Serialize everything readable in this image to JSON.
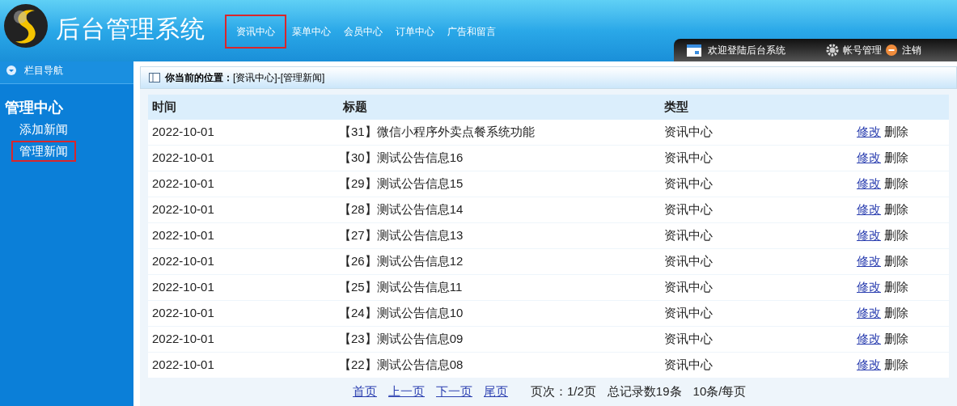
{
  "header": {
    "title": "后台管理系统",
    "nav": [
      {
        "label": "资讯中心",
        "selected": true
      },
      {
        "label": "菜单中心",
        "selected": false
      },
      {
        "label": "会员中心",
        "selected": false
      },
      {
        "label": "订单中心",
        "selected": false
      },
      {
        "label": "广告和留言",
        "selected": false
      }
    ],
    "welcome": "欢迎登陆后台系统",
    "account": "帐号管理",
    "logout": "注销"
  },
  "sidebar": {
    "heading": "栏目导航",
    "group": "管理中心",
    "items": [
      {
        "label": "添加新闻",
        "selected": false
      },
      {
        "label": "管理新闻",
        "selected": true
      }
    ]
  },
  "breadcrumb": {
    "label": "你当前的位置：",
    "path": "[资讯中心]-[管理新闻]"
  },
  "table": {
    "columns": [
      "时间",
      "标题",
      "类型",
      ""
    ],
    "rows": [
      {
        "time": "2022-10-01",
        "title": "【31】微信小程序外卖点餐系统功能",
        "type": "资讯中心",
        "edit": "修改",
        "delete": "删除"
      },
      {
        "time": "2022-10-01",
        "title": "【30】测试公告信息16",
        "type": "资讯中心",
        "edit": "修改",
        "delete": "删除"
      },
      {
        "time": "2022-10-01",
        "title": "【29】测试公告信息15",
        "type": "资讯中心",
        "edit": "修改",
        "delete": "删除"
      },
      {
        "time": "2022-10-01",
        "title": "【28】测试公告信息14",
        "type": "资讯中心",
        "edit": "修改",
        "delete": "删除"
      },
      {
        "time": "2022-10-01",
        "title": "【27】测试公告信息13",
        "type": "资讯中心",
        "edit": "修改",
        "delete": "删除"
      },
      {
        "time": "2022-10-01",
        "title": "【26】测试公告信息12",
        "type": "资讯中心",
        "edit": "修改",
        "delete": "删除"
      },
      {
        "time": "2022-10-01",
        "title": "【25】测试公告信息11",
        "type": "资讯中心",
        "edit": "修改",
        "delete": "删除"
      },
      {
        "time": "2022-10-01",
        "title": "【24】测试公告信息10",
        "type": "资讯中心",
        "edit": "修改",
        "delete": "删除"
      },
      {
        "time": "2022-10-01",
        "title": "【23】测试公告信息09",
        "type": "资讯中心",
        "edit": "修改",
        "delete": "删除"
      },
      {
        "time": "2022-10-01",
        "title": "【22】测试公告信息08",
        "type": "资讯中心",
        "edit": "修改",
        "delete": "删除"
      }
    ]
  },
  "pagination": {
    "links": [
      "首页",
      "上一页",
      "下一页",
      "尾页"
    ],
    "page": "页次：1/2页",
    "total": "总记录数19条",
    "per_page": "10条/每页"
  }
}
